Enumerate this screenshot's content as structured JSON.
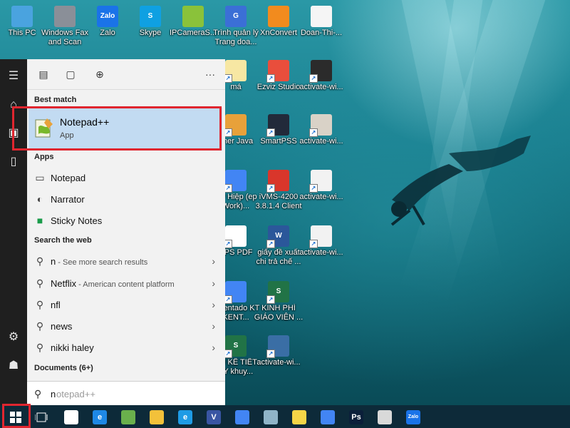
{
  "desktop": {
    "icons": [
      {
        "label": "This PC",
        "icon": "this-pc-icon",
        "color": "#4aa3df"
      },
      {
        "label": "Windows Fax and Scan",
        "icon": "fax-scan-icon",
        "color": "#8a8f98"
      },
      {
        "label": "Zalo",
        "icon": "zalo-icon",
        "color": "#1a73e8",
        "glyph": "Zalo"
      },
      {
        "label": "Skype",
        "icon": "skype-icon",
        "color": "#0fa0e2",
        "glyph": "S"
      },
      {
        "label": "IPCameraS...",
        "icon": "ipcamera-icon",
        "color": "#8ac23a"
      },
      {
        "label": "Trình quản lý Trang doa...",
        "icon": "page-manager-icon",
        "color": "#3b6fd6",
        "glyph": "G"
      },
      {
        "label": "XnConvert",
        "icon": "xnconvert-icon",
        "color": "#f28b1e"
      },
      {
        "label": "Doan-Thi-...",
        "icon": "document-icon",
        "color": "#f5f5f5"
      },
      {
        "label": "má",
        "icon": "file-icon",
        "color": "#f7e7a3"
      },
      {
        "label": "Ezviz Studio",
        "icon": "ezviz-icon",
        "color": "#e94e3c"
      },
      {
        "label": "activate-wi...",
        "icon": "image-file-icon",
        "color": "#2b2b2b"
      },
      {
        "label": "gner Java",
        "icon": "java-icon",
        "color": "#e8a13a"
      },
      {
        "label": "SmartPSS",
        "icon": "smartpss-icon",
        "color": "#222a3a"
      },
      {
        "label": "activate-wi...",
        "icon": "image-file-icon",
        "color": "#d9d2c7"
      },
      {
        "label": "Mỹ Hiệp (ep Work)...",
        "icon": "chrome-icon",
        "color": "#4285f4"
      },
      {
        "label": "iVMS-4200 3.8.1.4 Client",
        "icon": "ivms-icon",
        "color": "#d9362b"
      },
      {
        "label": "activate-wi...",
        "icon": "image-file-icon",
        "color": "#f2f2f2"
      },
      {
        "label": "VPS PDF",
        "icon": "pdf-icon",
        "color": "#ffffff"
      },
      {
        "label": "giấy đề xuất chi trả chế ...",
        "icon": "word-doc-icon",
        "color": "#2b579a",
        "glyph": "W"
      },
      {
        "label": "activate-wi...",
        "icon": "image-file-icon",
        "color": "#f2f2f2"
      },
      {
        "label": "T.Kentado KT KENT...",
        "icon": "chrome-icon",
        "color": "#4285f4"
      },
      {
        "label": "KINH PHÍ GIÁO VIÊN ...",
        "icon": "excel-sheet-icon",
        "color": "#217346",
        "glyph": "S"
      },
      {
        "label": "AU KẾ TIẾT AY khuy...",
        "icon": "excel-sheet-icon",
        "color": "#217346",
        "glyph": "S"
      },
      {
        "label": "activate-wi...",
        "icon": "image-file-icon",
        "color": "#3a6ea5"
      }
    ]
  },
  "start_menu": {
    "rail": {
      "icons": [
        "hamburger-icon",
        "home-icon",
        "contact-card-icon",
        "phone-icon",
        "settings-gear-icon",
        "user-icon"
      ]
    },
    "top_tabs": [
      "documents-tab-icon",
      "file-tab-icon",
      "web-tab-icon"
    ],
    "more_label": "···",
    "best_match": {
      "heading": "Best match",
      "name": "Notepad++",
      "type": "App"
    },
    "apps": {
      "heading": "Apps",
      "items": [
        {
          "label": "Notepad",
          "icon": "notepad-icon"
        },
        {
          "label": "Narrator",
          "icon": "narrator-icon"
        },
        {
          "label": "Sticky Notes",
          "icon": "sticky-notes-icon"
        }
      ]
    },
    "web": {
      "heading": "Search the web",
      "items": [
        {
          "label": "n",
          "sub": " - See more search results"
        },
        {
          "label": "Netflix",
          "sub": " - American content platform"
        },
        {
          "label": "nfl",
          "sub": ""
        },
        {
          "label": "news",
          "sub": ""
        },
        {
          "label": "nikki haley",
          "sub": ""
        }
      ]
    },
    "documents": {
      "heading": "Documents (6+)"
    },
    "search": {
      "typed": "n",
      "suggestion": "otepad++"
    }
  },
  "taskbar": {
    "items": [
      {
        "name": "start-button",
        "icon": "windows-logo-icon"
      },
      {
        "name": "task-view-button",
        "icon": "task-view-icon"
      },
      {
        "name": "mail-button",
        "icon": "mail-icon",
        "color": "#ffffff"
      },
      {
        "name": "edge-button",
        "icon": "edge-icon",
        "color": "#1e88e5",
        "glyph": "e"
      },
      {
        "name": "coccoc-button",
        "icon": "coccoc-icon",
        "color": "#6ab04c"
      },
      {
        "name": "explorer-button",
        "icon": "folder-icon",
        "color": "#f3c13a"
      },
      {
        "name": "ie-button",
        "icon": "internet-explorer-icon",
        "color": "#1e9be5",
        "glyph": "e"
      },
      {
        "name": "visio-button",
        "icon": "visio-icon",
        "color": "#3955a3",
        "glyph": "V"
      },
      {
        "name": "chrome-button",
        "icon": "chrome-icon",
        "color": "#4285f4"
      },
      {
        "name": "app-button",
        "icon": "app-icon",
        "color": "#8fb4c8"
      },
      {
        "name": "sticky-button",
        "icon": "sticky-notes-icon",
        "color": "#f5d547"
      },
      {
        "name": "chrome2-button",
        "icon": "chrome-icon",
        "color": "#4285f4"
      },
      {
        "name": "photoshop-button",
        "icon": "photoshop-icon",
        "color": "#0b1f3a",
        "glyph": "Ps"
      },
      {
        "name": "paint-button",
        "icon": "paint-icon",
        "color": "#d9d9d9"
      },
      {
        "name": "zalo-button",
        "icon": "zalo-icon",
        "color": "#1a73e8",
        "glyph": "Zalo"
      }
    ]
  },
  "colors": {
    "highlight": "#e0262f",
    "selection": "#c2dbf2",
    "taskbar": "#0d2a39",
    "rail": "#1f1f1f"
  }
}
